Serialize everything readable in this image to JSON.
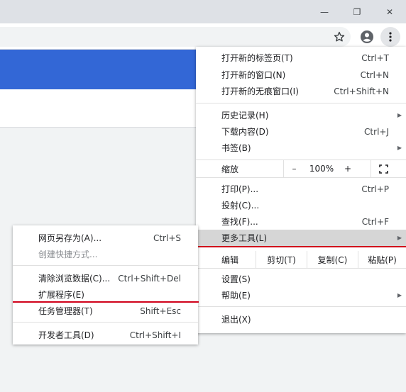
{
  "window": {
    "minimize_glyph": "—",
    "restore_glyph": "❐",
    "close_glyph": "✕"
  },
  "toolbar": {
    "bookmark_icon": "star-icon",
    "profile_icon": "account-icon",
    "menu_icon": "vertical-dots-icon"
  },
  "menu": {
    "new_tab": {
      "label": "打开新的标签页(T)",
      "shortcut": "Ctrl+T"
    },
    "new_window": {
      "label": "打开新的窗口(N)",
      "shortcut": "Ctrl+N"
    },
    "new_incognito": {
      "label": "打开新的无痕窗口(I)",
      "shortcut": "Ctrl+Shift+N"
    },
    "history": {
      "label": "历史记录(H)"
    },
    "downloads": {
      "label": "下载内容(D)",
      "shortcut": "Ctrl+J"
    },
    "bookmarks": {
      "label": "书签(B)"
    },
    "zoom": {
      "label": "缩放",
      "minus": "–",
      "value": "100%",
      "plus": "+"
    },
    "print": {
      "label": "打印(P)...",
      "shortcut": "Ctrl+P"
    },
    "cast": {
      "label": "投射(C)..."
    },
    "find": {
      "label": "查找(F)...",
      "shortcut": "Ctrl+F"
    },
    "more_tools": {
      "label": "更多工具(L)"
    },
    "edit": {
      "label": "编辑",
      "cut": "剪切(T)",
      "copy": "复制(C)",
      "paste": "粘贴(P)"
    },
    "settings": {
      "label": "设置(S)"
    },
    "help": {
      "label": "帮助(E)"
    },
    "exit": {
      "label": "退出(X)"
    },
    "arrow_glyph": "▶"
  },
  "submenu": {
    "save_page": {
      "label": "网页另存为(A)...",
      "shortcut": "Ctrl+S"
    },
    "create_shortcut": {
      "label": "创建快捷方式..."
    },
    "clear_data": {
      "label": "清除浏览数据(C)...",
      "shortcut": "Ctrl+Shift+Del"
    },
    "extensions": {
      "label": "扩展程序(E)"
    },
    "task_manager": {
      "label": "任务管理器(T)",
      "shortcut": "Shift+Esc"
    },
    "dev_tools": {
      "label": "开发者工具(D)",
      "shortcut": "Ctrl+Shift+I"
    }
  },
  "colors": {
    "accent_red": "#d0021b",
    "page_blue": "#3367d6",
    "highlight": "#d6d6d6"
  }
}
